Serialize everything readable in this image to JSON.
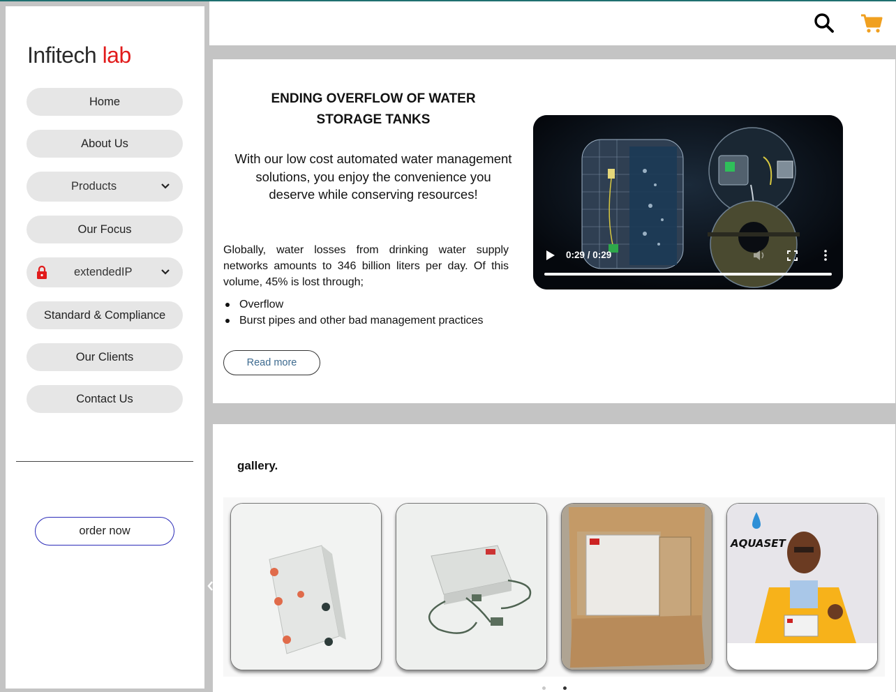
{
  "brand": {
    "name_part1": "Infitech",
    "name_part2": "lab",
    "accent_color": "#e11b1b"
  },
  "sidebar": {
    "items": [
      {
        "label": "Home"
      },
      {
        "label": "About Us"
      },
      {
        "label": "Products",
        "has_dropdown": true
      },
      {
        "label": "Our Focus"
      },
      {
        "label": "extendedIP",
        "has_dropdown": true,
        "icon": "lock-icon"
      },
      {
        "label": "Standard & Compliance"
      },
      {
        "label": "Our Clients"
      },
      {
        "label": "Contact Us"
      }
    ],
    "order_button": "order now"
  },
  "header": {
    "search_icon": "search-icon",
    "cart_icon": "cart-icon",
    "cart_color": "#f0a020"
  },
  "hero": {
    "title": "ENDING OVERFLOW OF WATER STORAGE TANKS",
    "subtitle": "With our low cost automated water management solutions, you enjoy the convenience you deserve while conserving resources!",
    "body": "Globally, water losses from drinking water supply networks amounts to 346 billion liters per day. Of this volume, 45% is lost through;",
    "bullets": [
      "Overflow",
      "Burst pipes and other bad management practices"
    ],
    "read_more": "Read more",
    "video": {
      "time": "0:29 / 0:29",
      "progress": 1.0
    }
  },
  "gallery": {
    "title": "gallery.",
    "card4_brand": "AQUASET",
    "active_page": 2,
    "page_count": 2
  }
}
